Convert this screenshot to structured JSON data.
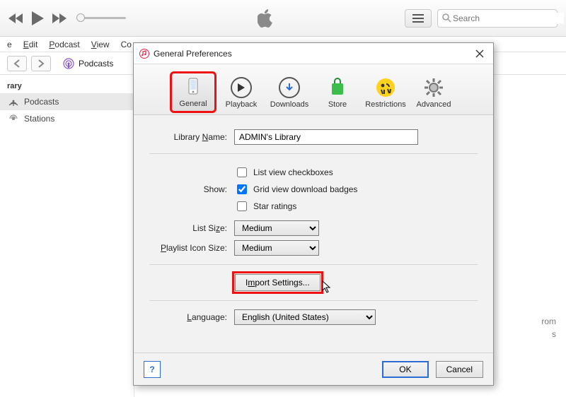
{
  "toolbar": {
    "search_placeholder": "Search"
  },
  "menubar": {
    "items": [
      "e",
      "Edit",
      "Podcast",
      "View",
      "Co"
    ]
  },
  "subbar": {
    "label": "Podcasts"
  },
  "sidebar": {
    "heading": "rary",
    "items": [
      {
        "label": "Podcasts",
        "active": true
      },
      {
        "label": "Stations",
        "active": false
      }
    ]
  },
  "bg_text": {
    "line1": "rom",
    "line2": "s"
  },
  "dialog": {
    "title": "General Preferences",
    "tabs": [
      {
        "key": "general",
        "label": "General",
        "active": true
      },
      {
        "key": "playback",
        "label": "Playback",
        "active": false
      },
      {
        "key": "downloads",
        "label": "Downloads",
        "active": false
      },
      {
        "key": "store",
        "label": "Store",
        "active": false
      },
      {
        "key": "restrictions",
        "label": "Restrictions",
        "active": false
      },
      {
        "key": "advanced",
        "label": "Advanced",
        "active": false
      }
    ],
    "library_name_label": "Library Name:",
    "library_name_value": "ADMIN's Library",
    "show_label": "Show:",
    "checks": {
      "list_view": {
        "label": "List view checkboxes",
        "checked": false
      },
      "grid_badges": {
        "label": "Grid view download badges",
        "checked": true
      },
      "star_ratings": {
        "label": "Star ratings",
        "checked": false
      }
    },
    "list_size_label": "List Size:",
    "list_size_value": "Medium",
    "playlist_icon_label": "Playlist Icon Size:",
    "playlist_icon_value": "Medium",
    "import_settings_label": "Import Settings...",
    "language_label": "Language:",
    "language_value": "English (United States)",
    "help_label": "?",
    "ok_label": "OK",
    "cancel_label": "Cancel"
  }
}
